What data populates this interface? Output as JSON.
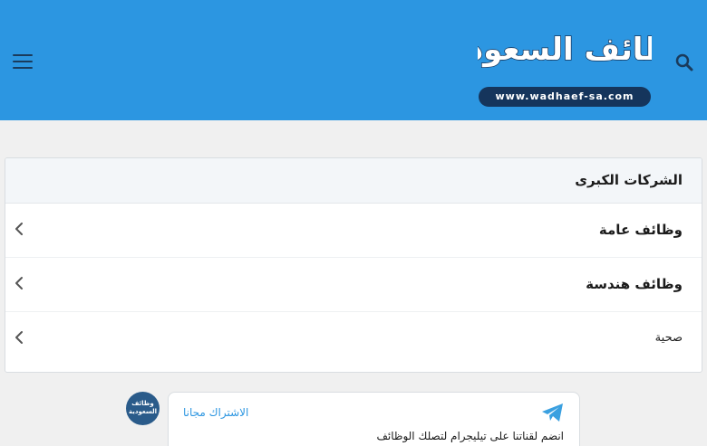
{
  "header": {
    "bg_color": "#2c96e1",
    "menu_icon": "hamburger-menu-icon",
    "search_icon": "search-icon",
    "logo": {
      "title": "وظائف السعودية",
      "url": "www.wadhaef-sa.com"
    }
  },
  "accordion": {
    "heading": "الشركات الكبرى",
    "items": [
      {
        "label": "وظائف عامة"
      },
      {
        "label": "وظائف هندسة"
      },
      {
        "label": "صحية"
      }
    ],
    "chevron_icon": "chevron-left-icon"
  },
  "telegram": {
    "icon": "telegram-icon",
    "link_text": "الاشتراك مجانا",
    "description": "انضم لقناتنا على تيليجرام لتصلك الوظائف"
  }
}
